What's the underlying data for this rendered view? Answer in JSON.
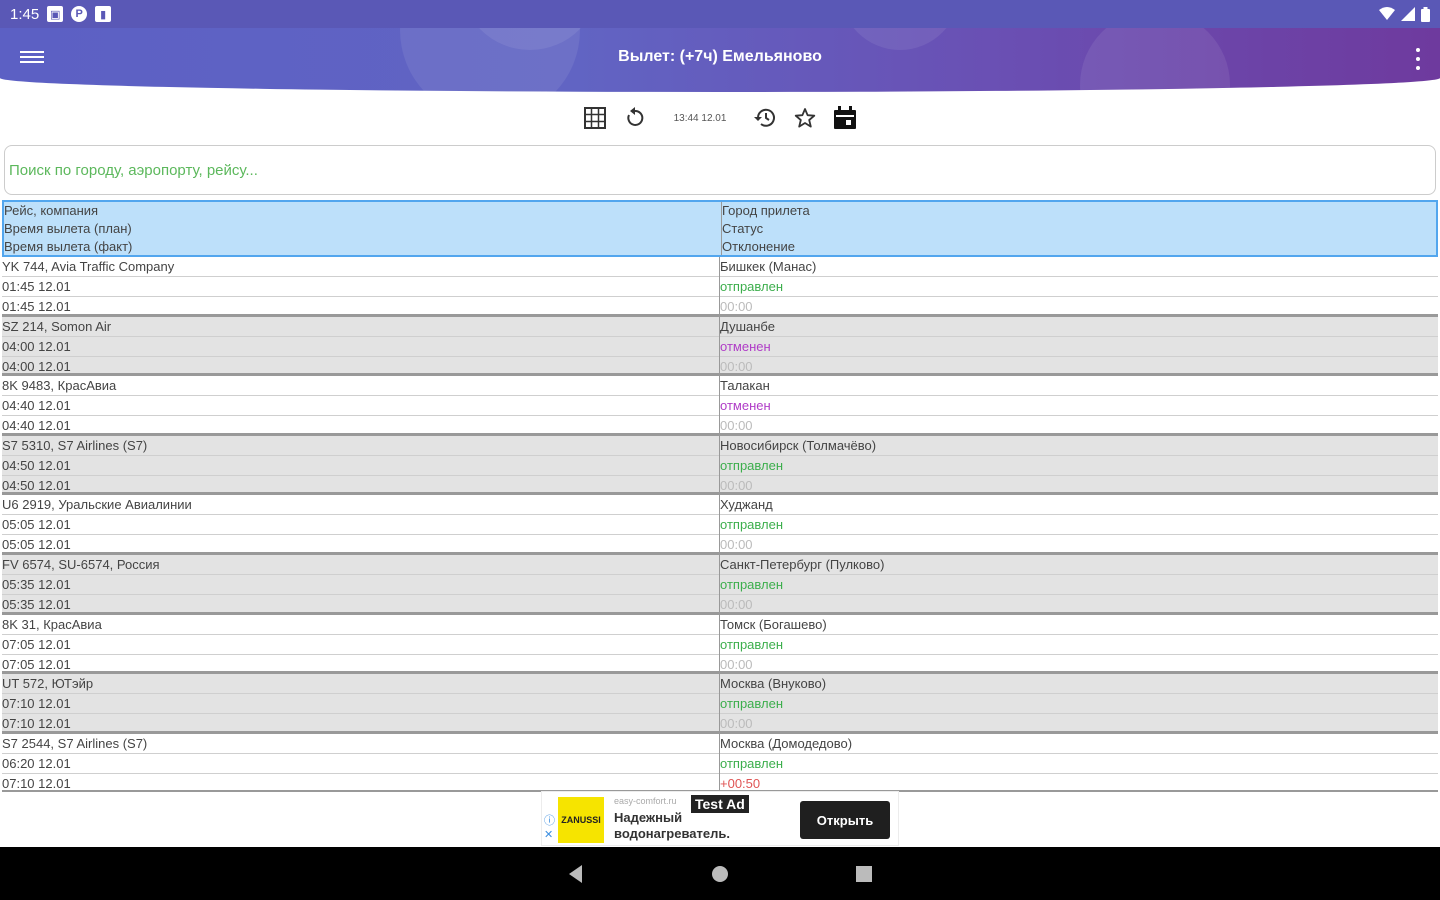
{
  "status_bar": {
    "time": "1:45",
    "icons_left": [
      "sim-card-icon",
      "p-icon",
      "sd-card-icon"
    ],
    "icons_right": [
      "wifi-icon",
      "signal-icon",
      "battery-icon"
    ]
  },
  "app_bar": {
    "title": "Вылет: (+7ч) Емельяново",
    "menu_icon": "hamburger-menu-icon",
    "more_icon": "more-vert-icon"
  },
  "toolbar": {
    "refresh_time": "13:44 12.01",
    "icons": [
      "grid-icon",
      "refresh-icon",
      "history-icon",
      "star-icon",
      "calendar-icon"
    ]
  },
  "search": {
    "placeholder": "Поиск по городу, аэропорту, рейсу..."
  },
  "table": {
    "header": {
      "left": [
        "Рейс, компания",
        "Время вылета (план)",
        "Время вылета (факт)"
      ],
      "right": [
        "Город прилета",
        "Статус",
        "Отклонение"
      ]
    },
    "rows": [
      {
        "flight": "YK 744, Avia Traffic Company",
        "plan": "01:45 12.01",
        "fact": "01:45 12.01",
        "city": "Бишкек (Манас)",
        "status": "отправлен",
        "status_kind": "green",
        "deviation": "00:00",
        "deviation_kind": "gray"
      },
      {
        "flight": "SZ 214, Somon Air",
        "plan": "04:00 12.01",
        "fact": "04:00 12.01",
        "city": "Душанбе",
        "status": "отменен",
        "status_kind": "purple",
        "deviation": "00:00",
        "deviation_kind": "gray"
      },
      {
        "flight": "8K 9483, КрасАвиа",
        "plan": "04:40 12.01",
        "fact": "04:40 12.01",
        "city": "Талакан",
        "status": "отменен",
        "status_kind": "purple",
        "deviation": "00:00",
        "deviation_kind": "gray"
      },
      {
        "flight": "S7 5310, S7 Airlines (S7)",
        "plan": "04:50 12.01",
        "fact": "04:50 12.01",
        "city": "Новосибирск (Толмачёво)",
        "status": "отправлен",
        "status_kind": "green",
        "deviation": "00:00",
        "deviation_kind": "gray"
      },
      {
        "flight": "U6 2919, Уральские Авиалинии",
        "plan": "05:05 12.01",
        "fact": "05:05 12.01",
        "city": "Худжанд",
        "status": "отправлен",
        "status_kind": "green",
        "deviation": "00:00",
        "deviation_kind": "gray"
      },
      {
        "flight": "FV 6574, SU-6574, Россия",
        "plan": "05:35 12.01",
        "fact": "05:35 12.01",
        "city": "Санкт-Петербург (Пулково)",
        "status": "отправлен",
        "status_kind": "green",
        "deviation": "00:00",
        "deviation_kind": "gray"
      },
      {
        "flight": "8K 31, КрасАвиа",
        "plan": "07:05 12.01",
        "fact": "07:05 12.01",
        "city": "Томск (Богашево)",
        "status": "отправлен",
        "status_kind": "green",
        "deviation": "00:00",
        "deviation_kind": "gray"
      },
      {
        "flight": "UT 572, ЮТэйр",
        "plan": "07:10 12.01",
        "fact": "07:10 12.01",
        "city": "Москва (Внуково)",
        "status": "отправлен",
        "status_kind": "green",
        "deviation": "00:00",
        "deviation_kind": "gray"
      },
      {
        "flight": "S7 2544, S7 Airlines (S7)",
        "plan": "06:20 12.01",
        "fact": "07:10 12.01",
        "city": "Москва (Домодедово)",
        "status": "отправлен",
        "status_kind": "green",
        "deviation": "+00:50",
        "deviation_kind": "red"
      }
    ]
  },
  "ad": {
    "logo_text": "ZANUSSI",
    "source": "easy-comfort.ru",
    "badge": "Test Ad",
    "text": "Надежный водонагреватель.",
    "button": "Открыть"
  },
  "nav_bar": {
    "icons": [
      "back-icon",
      "home-icon",
      "recents-icon"
    ]
  },
  "colors": {
    "header_bg": "#bde0fa",
    "header_border": "#52a6ee",
    "status_green": "#3cae4c",
    "status_purple": "#b03cc7",
    "deviation_red": "#e05555"
  }
}
